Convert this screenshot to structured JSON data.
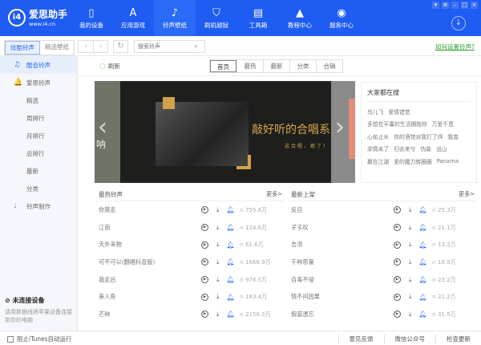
{
  "header": {
    "logo_name": "爱思助手",
    "logo_url": "www.i4.cn",
    "logo_badge": "i4",
    "nav": [
      {
        "label": "我的设备",
        "icon": "phone-icon"
      },
      {
        "label": "应用游戏",
        "icon": "appstore-icon"
      },
      {
        "label": "铃声壁纸",
        "icon": "music-file-icon",
        "active": true
      },
      {
        "label": "刷机越狱",
        "icon": "shield-icon"
      },
      {
        "label": "工具箱",
        "icon": "toolbox-icon"
      },
      {
        "label": "教程中心",
        "icon": "graduation-cap-icon"
      },
      {
        "label": "服务中心",
        "icon": "compass-icon"
      }
    ]
  },
  "toolbar": {
    "seg": [
      "炫酷铃声",
      "精选壁纸"
    ],
    "search_placeholder": "搜索铃声",
    "howto": "如何设置铃声?"
  },
  "sidebar": {
    "items": [
      {
        "label": "酷音铃声",
        "head": true,
        "active": true
      },
      {
        "label": "爱思铃声",
        "head": true
      },
      {
        "label": "精选"
      },
      {
        "label": "周排行"
      },
      {
        "label": "月排行"
      },
      {
        "label": "总排行"
      },
      {
        "label": "最新"
      },
      {
        "label": "分类"
      },
      {
        "label": "铃声制作",
        "head": true
      }
    ],
    "device_title": "未连接设备",
    "device_desc": "请用数据线将苹果设备连接到你的电脑"
  },
  "content": {
    "refresh": "刷新",
    "tabs": [
      "首页",
      "最热",
      "最新",
      "分类",
      "合辑"
    ],
    "active_tab": "首页"
  },
  "banner": {
    "title": "敲好听的合唱系列",
    "subtitle": "这合唱，绝了！",
    "left_text": "呐"
  },
  "hot_search": {
    "title": "大家都在搜",
    "rows": [
      [
        "鸟儿飞",
        "爱情错觉"
      ],
      [
        "多想在平庸的生活拥抱你",
        "万爱千恩"
      ],
      [
        "心如止水",
        "你的酒馆对我打了烊",
        "我曾"
      ],
      [
        "余情未了",
        "归去来兮",
        "伪装",
        "出山"
      ],
      [
        "赢在江湖",
        "爱的魔力转圈圈",
        "Panama"
      ]
    ]
  },
  "hot_list": {
    "title": "最热铃声",
    "more": "更多>",
    "items": [
      {
        "name": "你莫走",
        "count": "755.8万"
      },
      {
        "name": "江南",
        "count": "124.6万"
      },
      {
        "name": "天外来物",
        "count": "61.6万"
      },
      {
        "name": "可不可以(翻唱抖音版)",
        "count": "1666.9万"
      },
      {
        "name": "我走后",
        "count": "976.5万"
      },
      {
        "name": "美人鱼",
        "count": "183.4万"
      },
      {
        "name": "芒种",
        "count": "2156.3万"
      }
    ]
  },
  "new_list": {
    "title": "最新上架",
    "more": "更多>",
    "items": [
      {
        "name": "反目",
        "count": "25.3万"
      },
      {
        "name": "孑孓叹",
        "count": "21.1万"
      },
      {
        "name": "击溃",
        "count": "13.2万"
      },
      {
        "name": "千种思量",
        "count": "18.5万"
      },
      {
        "name": "百毒不侵",
        "count": "23.2万"
      },
      {
        "name": "情不问因果",
        "count": "21.2万"
      },
      {
        "name": "假装遗忘",
        "count": "31.5万"
      }
    ]
  },
  "footer": {
    "itunes": "阻止iTunes自动运行",
    "links": [
      "意见反馈",
      "微信公众号",
      "检查更新"
    ]
  },
  "colors": {
    "brand": "#1f5cf2",
    "link": "#2ca02c",
    "banner_gold": "#d6a84a"
  }
}
